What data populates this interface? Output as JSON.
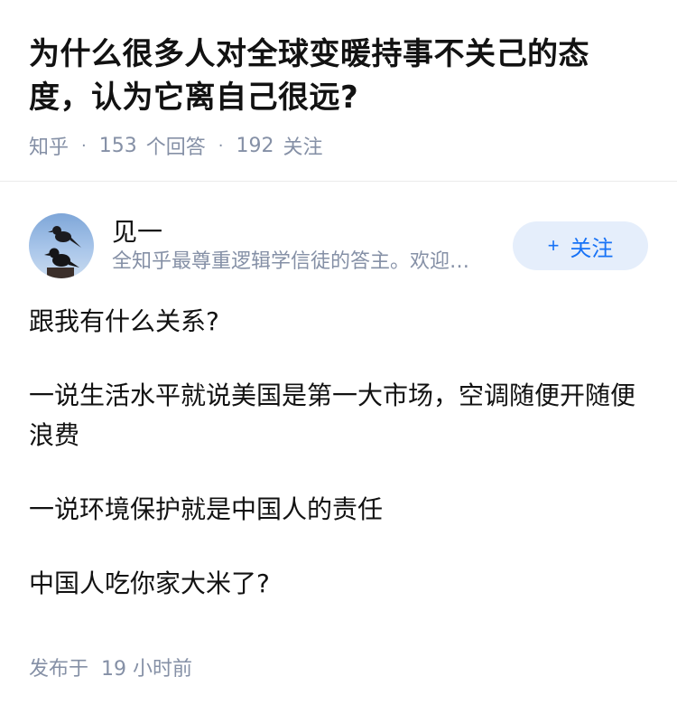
{
  "question": {
    "title": "为什么很多人对全球变暖持事不关己的态度，认为它离自己很远?",
    "source": "知乎",
    "answer_count": "153",
    "answer_label": "个回答",
    "follower_count": "192",
    "follower_label": "关注"
  },
  "answer": {
    "author_name": "见一",
    "author_bio": "全知乎最尊重逻辑学信徒的答主。欢迎来辩",
    "follow_button": "关注",
    "paragraphs": [
      "跟我有什么关系?",
      "一说生活水平就说美国是第一大市场，空调随便开随便浪费",
      "一说环境保护就是中国人的责任",
      "中国人吃你家大米了?"
    ],
    "time_prefix": "发布于",
    "time_value": "19 小时前"
  },
  "colors": {
    "title": "#121212",
    "meta": "#8590a6",
    "follow_bg": "#e5eefb",
    "follow_text": "#1772f6"
  }
}
